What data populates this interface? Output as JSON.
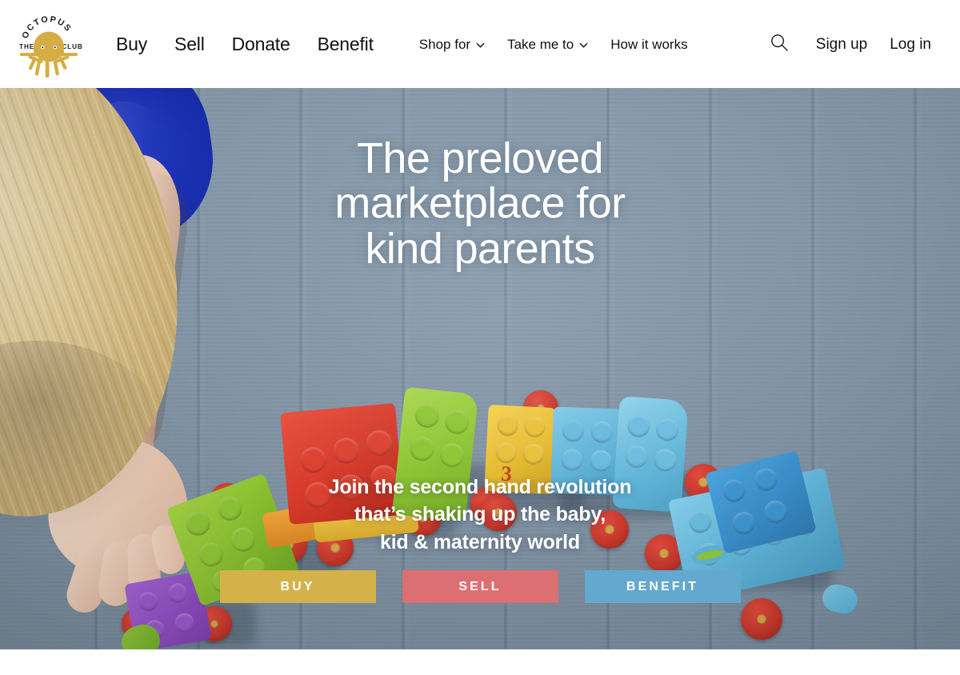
{
  "brand": {
    "name": "The Octopus Club",
    "logo_word_top": "OCTOPUS",
    "logo_word_left": "THE",
    "logo_word_right": "CLUB",
    "logo_color": "#D4AE44"
  },
  "header": {
    "primary_nav": [
      {
        "label": "Buy"
      },
      {
        "label": "Sell"
      },
      {
        "label": "Donate"
      },
      {
        "label": "Benefit"
      }
    ],
    "secondary_nav": [
      {
        "label": "Shop for",
        "has_dropdown": true,
        "icon": "chevron-down-icon"
      },
      {
        "label": "Take me to",
        "has_dropdown": true,
        "icon": "chevron-down-icon"
      },
      {
        "label": "How it works",
        "has_dropdown": false
      }
    ],
    "search_icon": "search-icon",
    "account": [
      {
        "label": "Sign up"
      },
      {
        "label": "Log in"
      }
    ]
  },
  "hero": {
    "headline_line1": "The preloved",
    "headline_line2": "marketplace for",
    "headline_line3": "kind parents",
    "subcopy_line1": "Join the second hand revolution",
    "subcopy_line2": "that’s shaking up the baby,",
    "subcopy_line3": "kid & maternity world",
    "image_alt": "Blonde toddler in a blue shirt reaching for a colourful building-block toy train on a grey painted wooden deck",
    "background_color": "#7f96a9",
    "buttons": [
      {
        "label": "BUY",
        "color": "#D4B249"
      },
      {
        "label": "SELL",
        "color": "#DC6F72"
      },
      {
        "label": "BENEFIT",
        "color": "#63A8CE"
      }
    ],
    "toy_train": {
      "number_printed_on_block": "3",
      "car_colors": [
        "purple",
        "green",
        "red",
        "green",
        "yellow",
        "blue",
        "blue"
      ]
    }
  }
}
